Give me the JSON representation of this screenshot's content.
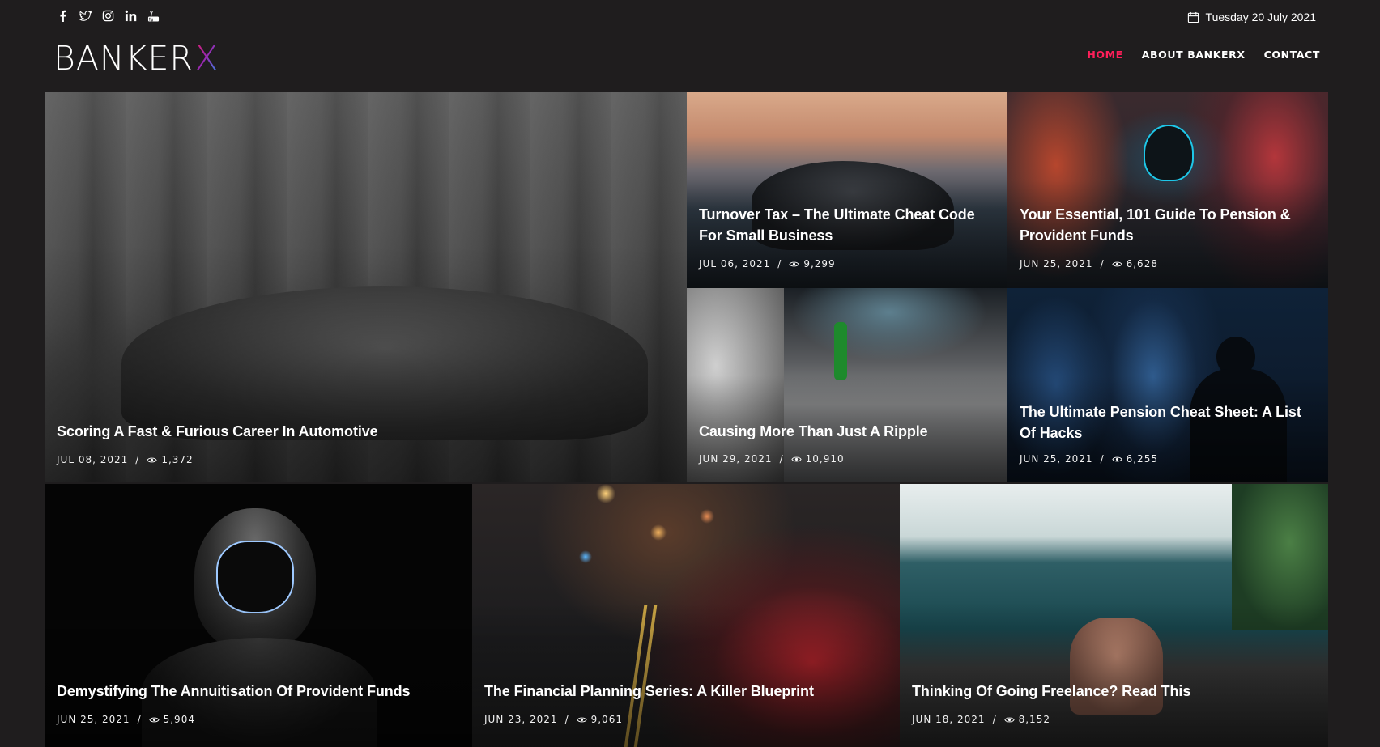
{
  "header": {
    "social": [
      "facebook-icon",
      "twitter-icon",
      "instagram-icon",
      "linkedin-icon",
      "youtube-icon"
    ],
    "date": "Tuesday 20 July 2021",
    "logo": {
      "word": "BANKER",
      "accent": "X"
    },
    "nav": [
      {
        "label": "HOME",
        "active": true
      },
      {
        "label": "ABOUT BANKERX",
        "active": false
      },
      {
        "label": "CONTACT",
        "active": false
      }
    ]
  },
  "colors": {
    "accent": "#ff1f5a",
    "background": "#1f1d1e"
  },
  "articles": [
    {
      "title": "Scoring A Fast & Furious Career In Automotive",
      "date": "JUL 08, 2021",
      "views": "1,372"
    },
    {
      "title": "Turnover Tax – The Ultimate Cheat Code For Small Business",
      "date": "JUL 06, 2021",
      "views": "9,299"
    },
    {
      "title": "Your Essential, 101 Guide To Pension & Provident Funds",
      "date": "JUN 25, 2021",
      "views": "6,628"
    },
    {
      "title": "Causing More Than Just A Ripple",
      "date": "JUN 29, 2021",
      "views": "10,910"
    },
    {
      "title": "The Ultimate Pension Cheat Sheet: A List Of Hacks",
      "date": "JUN 25, 2021",
      "views": "6,255"
    },
    {
      "title": "Demystifying The Annuitisation Of Provident Funds",
      "date": "JUN 25, 2021",
      "views": "5,904"
    },
    {
      "title": "The Financial Planning Series: A Killer Blueprint",
      "date": "JUN 23, 2021",
      "views": "9,061"
    },
    {
      "title": "Thinking Of Going Freelance? Read This",
      "date": "JUN 18, 2021",
      "views": "8,152"
    }
  ]
}
